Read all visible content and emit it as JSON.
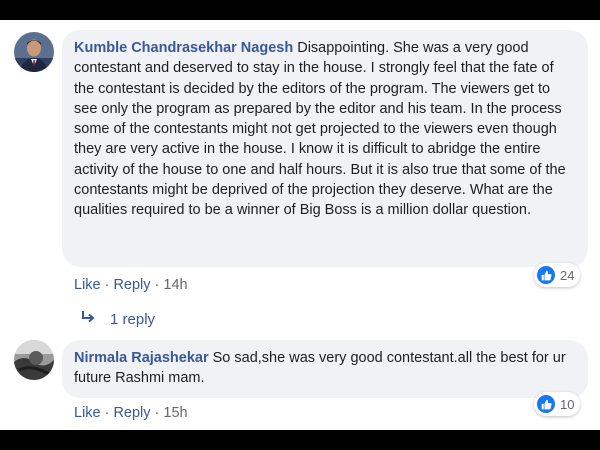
{
  "comments": [
    {
      "author": "Kumble Chandrasekhar Nagesh",
      "text": "Disappointing. She was a very good contestant and deserved to stay in the house. I strongly feel that the fate of the contestant is decided by the editors of the program. The viewers get to see only the program as prepared by the editor and his team. In the process some of the contestants might not get projected to the viewers even though they are very active in the house. I know it is difficult to abridge the entire activity of the house to one and half hours. But it is also true that some of the contestants might be deprived of the projection they deserve. What are the qualities required to be a winner of Big Boss is a million dollar question.",
      "like_label": "Like",
      "reply_label": "Reply",
      "time": "14h",
      "reaction_count": "24",
      "reply_count_label": "1 reply",
      "reaction_icon": "thumbs-up-icon",
      "avatar_icon": "profile-photo-man-suit"
    },
    {
      "author": "Nirmala Rajashekar",
      "text": "So sad,she was very good contestant.all the best for ur future Rashmi mam.",
      "like_label": "Like",
      "reply_label": "Reply",
      "time": "15h",
      "reaction_count": "10",
      "reaction_icon": "thumbs-up-icon",
      "avatar_icon": "profile-photo-grayscale"
    }
  ],
  "colors": {
    "author": "#385898",
    "bubble": "#f0f2f5",
    "like_badge": "#1877f2",
    "meta": "#65676b"
  }
}
